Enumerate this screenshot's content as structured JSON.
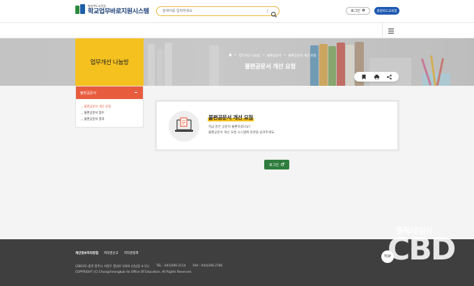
{
  "header": {
    "logo_sub": "충청북도교육청",
    "logo_main": "학교업무바로지원시스템",
    "search_placeholder": "검색어를 입력하세요",
    "login_label": "로그인",
    "office_label": "충청북도교육청"
  },
  "banner": {
    "side_title": "업무개선 나눔방",
    "breadcrumb": [
      "업무개선 나눔방",
      "불편공문서",
      "불편공문서 개선 요청"
    ],
    "page_title": "불편공문서 개선 요청"
  },
  "sidebar": {
    "heading": "불편공문서",
    "items": [
      {
        "label": "불편공문서 개선 요청",
        "active": true
      },
      {
        "label": "불편공문서 접수",
        "active": false
      },
      {
        "label": "불편공문서 결과",
        "active": false
      }
    ]
  },
  "card": {
    "title": "불편공문서 개선 요청",
    "line1": "지금 받은 공문이 불편하셨나요?",
    "line2": "불편공문서 개선 요청 시스템에 의견을 남겨주세요."
  },
  "login_button": "로그인",
  "footer": {
    "links": [
      "개인정보처리방침",
      "저작권신고",
      "저작권정책"
    ],
    "address": "(28635) 충북 청주시 서원구 청남로 1929 (산남동 4-11)",
    "tel": "TEL : 043)290-2114",
    "fax": "FAX : 043)290-2760",
    "copyright": "COPYRIGHT (C) Chungcheongbuk-do Office Of Education. All Rights Reserved.",
    "top_label": "TOP"
  },
  "watermark": {
    "small": "충북데일리",
    "big": "CBD"
  },
  "colors": {
    "accent_yellow": "#f4c11f",
    "sidebar_red": "#e85c3e",
    "login_green": "#2f7d3e",
    "office_blue": "#1d58b0",
    "footer_dark": "#3f3f3f"
  }
}
